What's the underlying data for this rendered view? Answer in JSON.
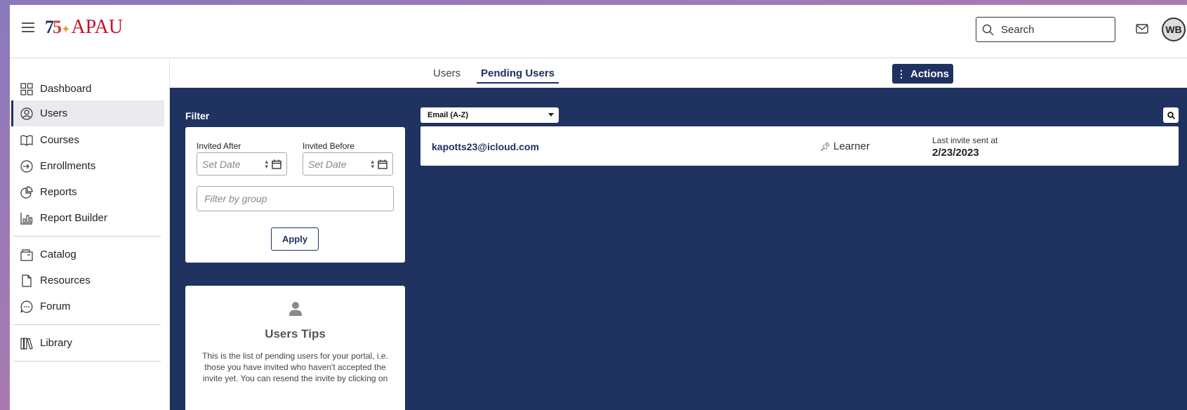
{
  "header": {
    "logo_num_a": "7",
    "logo_num_b": "5",
    "logo_word": "APAU",
    "search_placeholder": "Search",
    "avatar_initials": "WB"
  },
  "sidebar": {
    "items": [
      {
        "label": "Dashboard",
        "icon": "dashboard-icon"
      },
      {
        "label": "Users",
        "icon": "user-circle-icon",
        "active": true
      },
      {
        "label": "Courses",
        "icon": "book-icon"
      },
      {
        "label": "Enrollments",
        "icon": "enroll-icon"
      },
      {
        "label": "Reports",
        "icon": "pie-chart-icon"
      },
      {
        "label": "Report Builder",
        "icon": "bar-chart-icon"
      },
      {
        "label": "Catalog",
        "icon": "catalog-icon"
      },
      {
        "label": "Resources",
        "icon": "file-icon"
      },
      {
        "label": "Forum",
        "icon": "chat-icon"
      },
      {
        "label": "Library",
        "icon": "library-icon"
      }
    ]
  },
  "tabs": {
    "users": "Users",
    "pending": "Pending Users",
    "actions": "Actions"
  },
  "filter": {
    "title": "Filter",
    "invited_after": "Invited After",
    "invited_before": "Invited Before",
    "date_placeholder": "Set Date",
    "group_placeholder": "Filter by group",
    "apply": "Apply"
  },
  "tips": {
    "title": "Users Tips",
    "text": "This is the list of pending users for your portal, i.e. those you have invited who haven't accepted the invite yet. You can resend the invite by clicking on"
  },
  "list": {
    "sort_value": "Email (A-Z)",
    "rows": [
      {
        "email": "kapotts23@icloud.com",
        "role": "Learner",
        "invite_label": "Last invite sent at",
        "invite_date": "2/23/2023"
      }
    ]
  },
  "colors": {
    "navy": "#203260",
    "accent": "#1f3160"
  }
}
